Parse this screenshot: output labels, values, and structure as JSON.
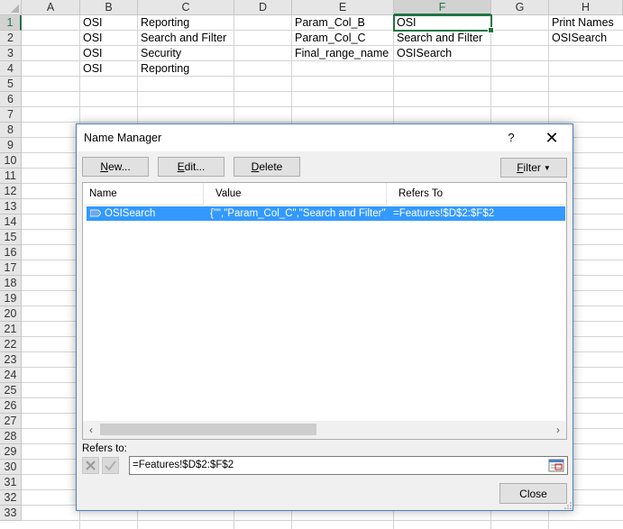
{
  "spreadsheet": {
    "columns": [
      "A",
      "B",
      "C",
      "D",
      "E",
      "F",
      "G",
      "H"
    ],
    "selected_column": "F",
    "rows": [
      "1",
      "2",
      "3",
      "4",
      "5",
      "6",
      "7",
      "8",
      "9",
      "10",
      "11",
      "12",
      "13",
      "14",
      "15",
      "16",
      "17",
      "18",
      "19",
      "20",
      "21",
      "22",
      "23",
      "24",
      "25",
      "26",
      "27",
      "28",
      "29",
      "30",
      "31",
      "32",
      "33"
    ],
    "selected_row": "1",
    "cells": {
      "B1": "OSI",
      "C1": "Reporting",
      "E1": "Param_Col_B",
      "F1": "OSI",
      "H1": "Print Names",
      "B2": "OSI",
      "C2": "Search and Filter",
      "E2": "Param_Col_C",
      "F2": "Search and Filter",
      "H2": "OSISearch",
      "B3": "OSI",
      "C3": "Security",
      "E3": "Final_range_name",
      "F3": "OSISearch",
      "B4": "OSI",
      "C4": "Reporting"
    }
  },
  "dialog": {
    "title": "Name Manager",
    "help_label": "?",
    "close_label": "✕",
    "buttons": {
      "new": "New...",
      "edit": "Edit...",
      "delete": "Delete",
      "filter": "Filter"
    },
    "columns": {
      "name": "Name",
      "value": "Value",
      "refers_to": "Refers To"
    },
    "rows": [
      {
        "icon": "named-range-icon",
        "name": "OSISearch",
        "value": "{\"\",\"Param_Col_C\",\"Search and Filter\"}",
        "refers_to": "=Features!$D$2:$F$2"
      }
    ],
    "refers_to_label": "Refers to:",
    "refers_to_value": "=Features!$D$2:$F$2",
    "close_button": "Close"
  },
  "colors": {
    "accent_green": "#217346",
    "selection_blue": "#3399ff",
    "dialog_border": "#4a7fc0"
  }
}
